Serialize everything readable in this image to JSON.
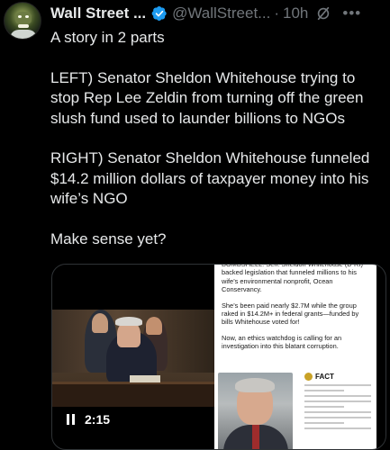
{
  "author": {
    "name": "Wall Street ...",
    "handle": "@WallStreet...",
    "separator": "·",
    "time": "10h"
  },
  "icons": {
    "verified": "verified-badge-icon",
    "grok": "grok-icon",
    "more": "more-options-icon",
    "pause": "pause-icon"
  },
  "post": {
    "paragraphs": [
      "A story in 2 parts",
      "LEFT) Senator Sheldon Whitehouse trying to stop Rep Lee Zeldin from turning off the green slush fund used to launder billions to NGOs",
      "RIGHT) Senator Sheldon Whitehouse funneled $14.2 million dollars of taxpayer money into his wife’s NGO",
      "Make sense yet?"
    ]
  },
  "media": {
    "video_time": "2:15",
    "doc_paragraphs": [
      "BOMBSHELL: Sen. Sheldon Whitehouse (D-RI) backed legislation that funneled millions to his wife’s environmental nonprofit, Ocean Conservancy.",
      "She’s been paid nearly $2.7M while the group raked in $14.2M+ in federal grants—funded by bills Whitehouse voted for!",
      "Now, an ethics watchdog is calling for an investigation into this blatant corruption."
    ],
    "fact_label": "FACT"
  },
  "colors": {
    "background": "#000000",
    "text": "#e7e9ea",
    "muted": "#71767b",
    "verified": "#1d9bf0"
  }
}
